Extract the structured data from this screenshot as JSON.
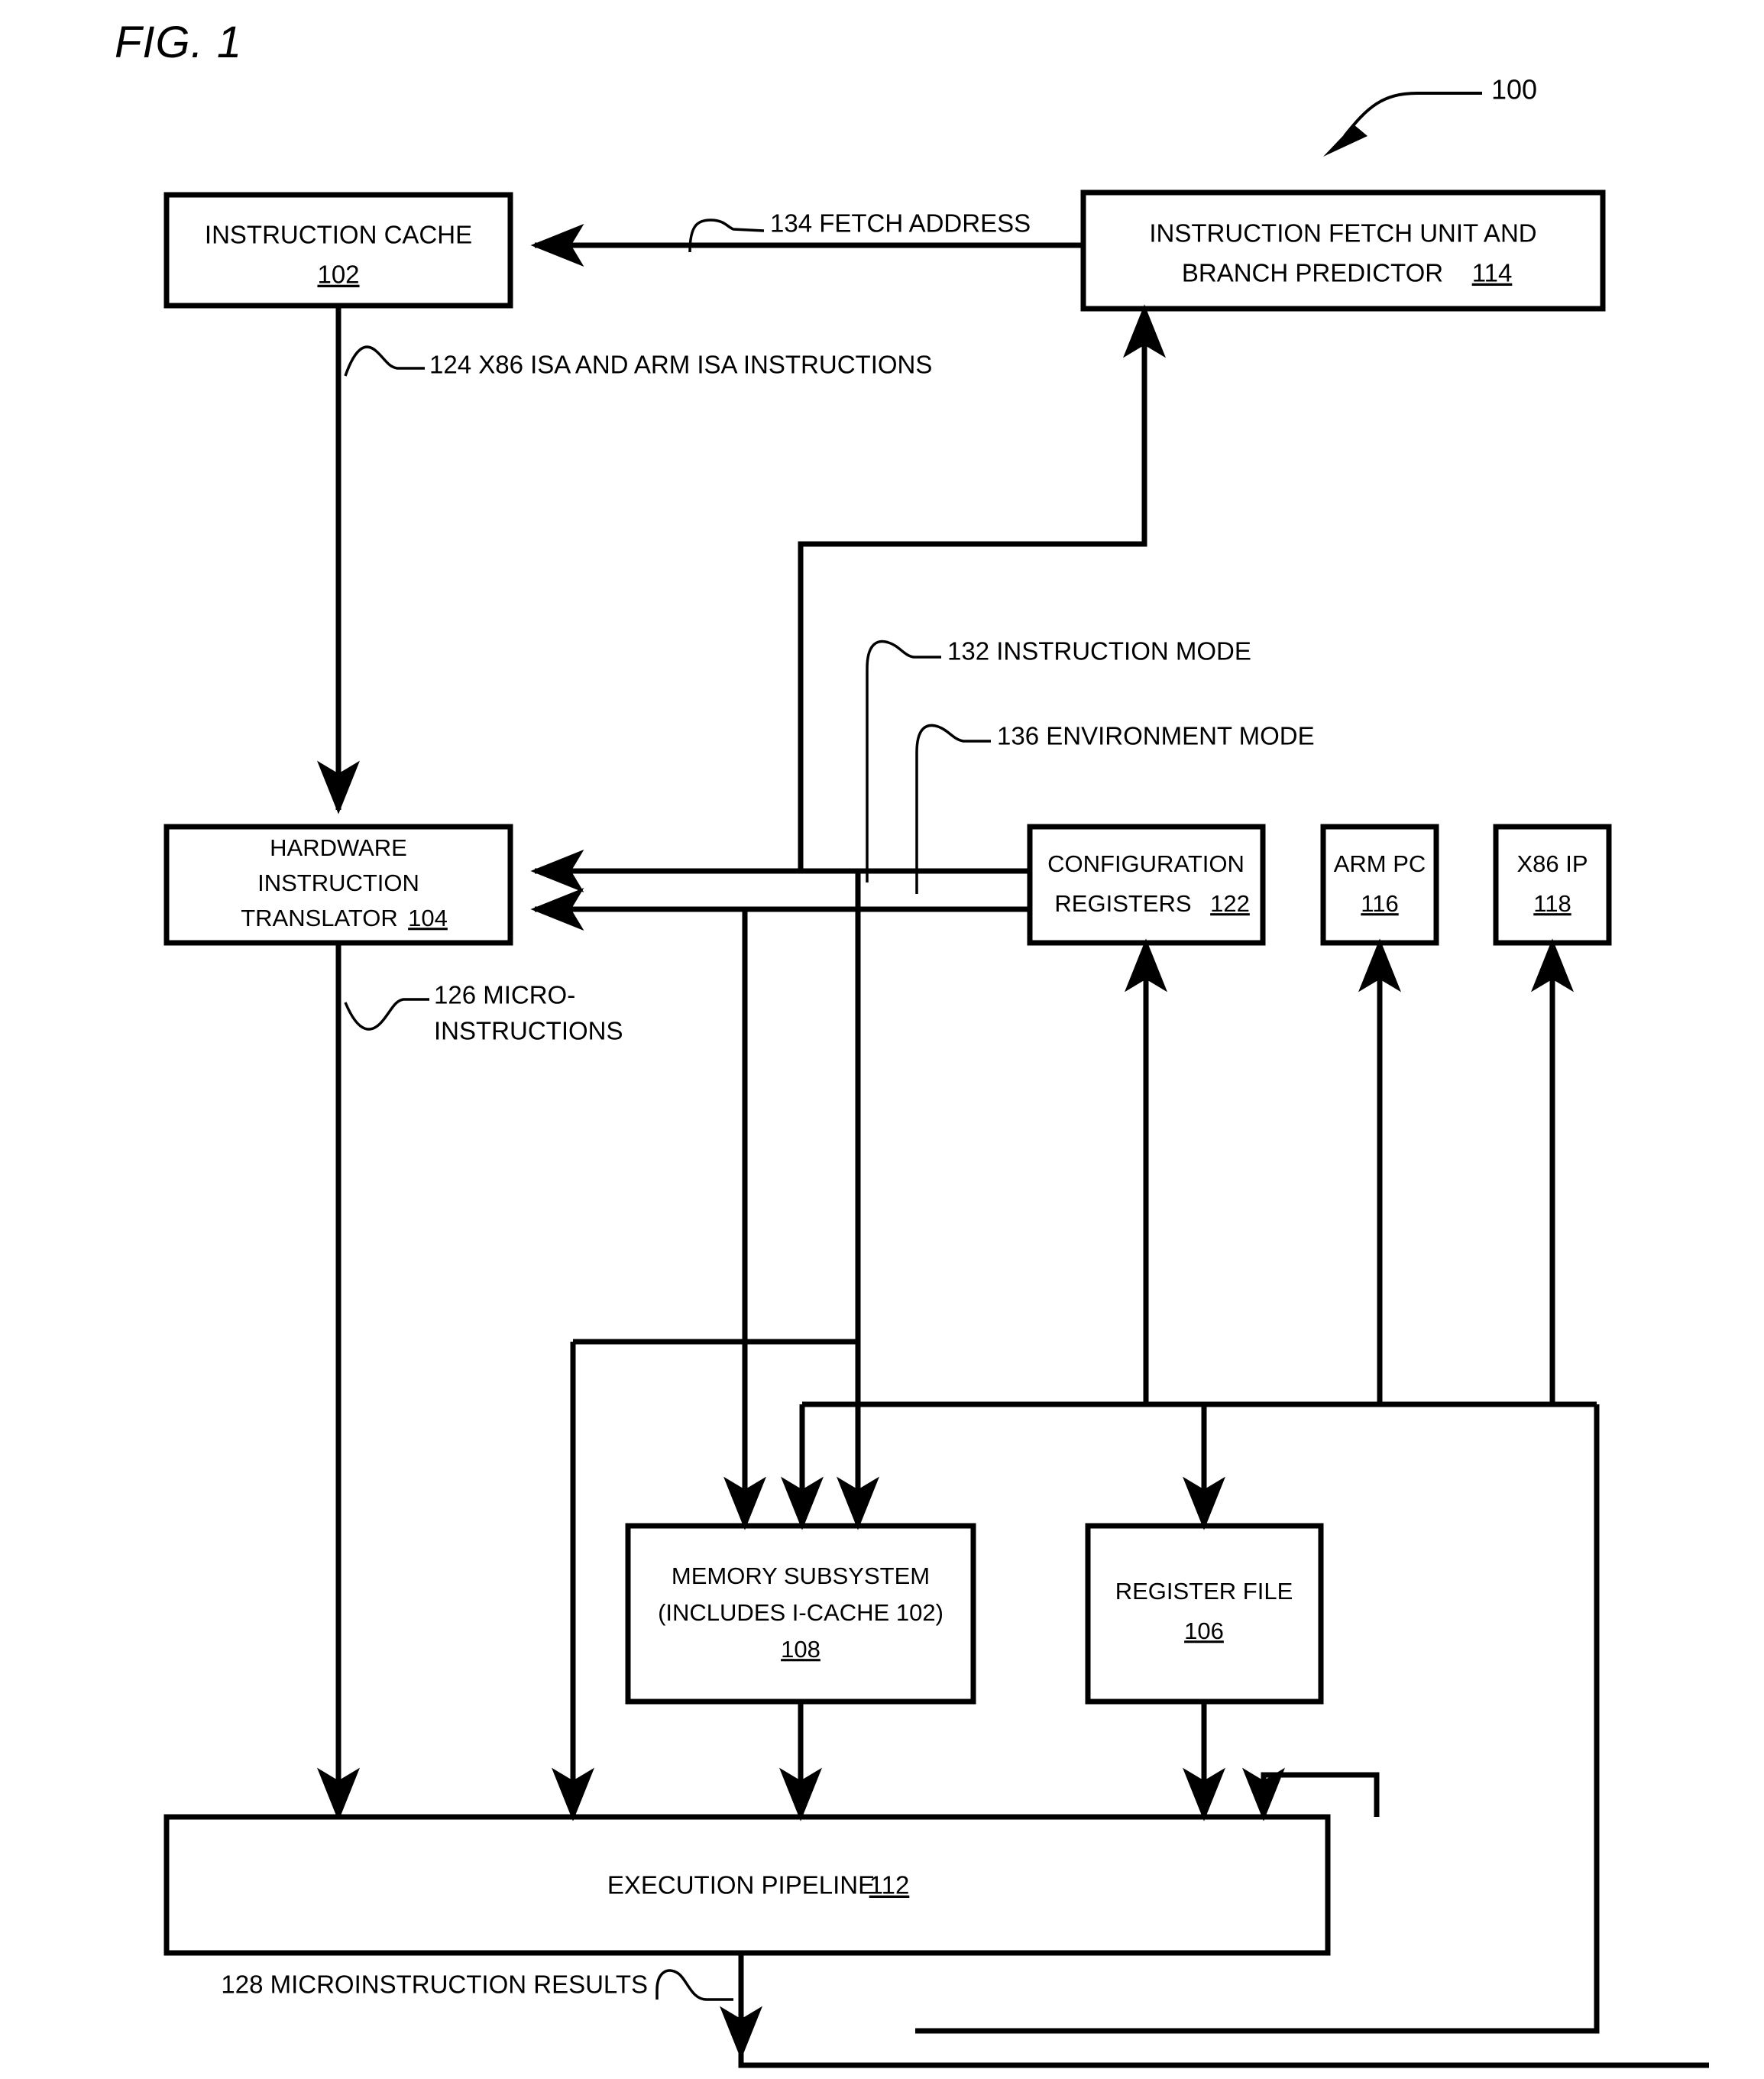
{
  "figure": {
    "title": "FIG. 1",
    "system_ref": "100"
  },
  "boxes": {
    "instruction_cache": {
      "line1": "INSTRUCTION CACHE",
      "ref": "102"
    },
    "instruction_fetch_unit": {
      "line1": "INSTRUCTION FETCH UNIT AND",
      "line2": "BRANCH PREDICTOR",
      "ref": "114"
    },
    "hardware_translator": {
      "line1": "HARDWARE",
      "line2": "INSTRUCTION",
      "line3": "TRANSLATOR",
      "ref": "104"
    },
    "configuration_registers": {
      "line1": "CONFIGURATION",
      "line2": "REGISTERS",
      "ref": "122"
    },
    "arm_pc": {
      "line1": "ARM PC",
      "ref": "116"
    },
    "x86_ip": {
      "line1": "X86 IP",
      "ref": "118"
    },
    "memory_subsystem": {
      "line1": "MEMORY SUBSYSTEM",
      "line2": "(INCLUDES I-CACHE 102)",
      "ref": "108"
    },
    "register_file": {
      "line1": "REGISTER FILE",
      "ref": "106"
    },
    "execution_pipeline": {
      "line1": "EXECUTION PIPELINE",
      "ref": "112"
    }
  },
  "signals": {
    "fetch_address": "134 FETCH ADDRESS",
    "isa_instructions": "124 X86 ISA AND ARM ISA INSTRUCTIONS",
    "instruction_mode": "132 INSTRUCTION MODE",
    "environment_mode": "136 ENVIRONMENT MODE",
    "microinstructions_line1": "126 MICRO-",
    "microinstructions_line2": "INSTRUCTIONS",
    "microinstruction_results": "128 MICROINSTRUCTION RESULTS"
  },
  "colors": {
    "stroke": "#000000",
    "background": "#ffffff"
  }
}
